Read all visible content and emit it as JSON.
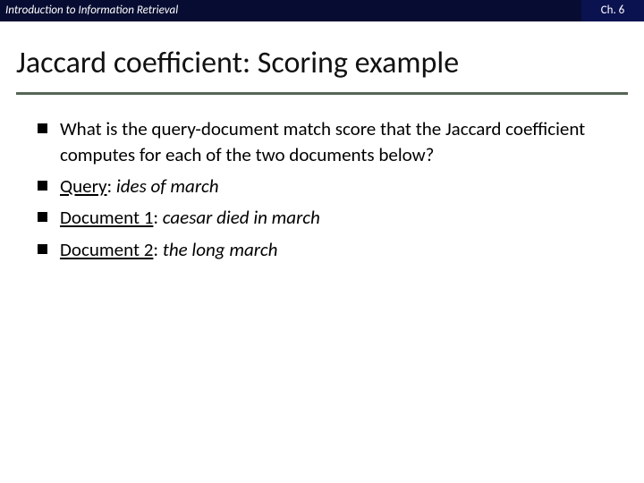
{
  "header": {
    "left": "Introduction to Information Retrieval",
    "right": "Ch. 6"
  },
  "title": "Jaccard coefficient: Scoring example",
  "bullets": {
    "b0": "What is the query-document match score that the Jaccard coefficient computes for each of the two documents below?",
    "b1_label": "Query",
    "b1_sep": ": ",
    "b1_val": "ides of march",
    "b2_label": "Document 1",
    "b2_sep": ": ",
    "b2_val": "caesar died in march",
    "b3_label": "Document 2",
    "b3_sep": ": ",
    "b3_val": "the long march"
  }
}
